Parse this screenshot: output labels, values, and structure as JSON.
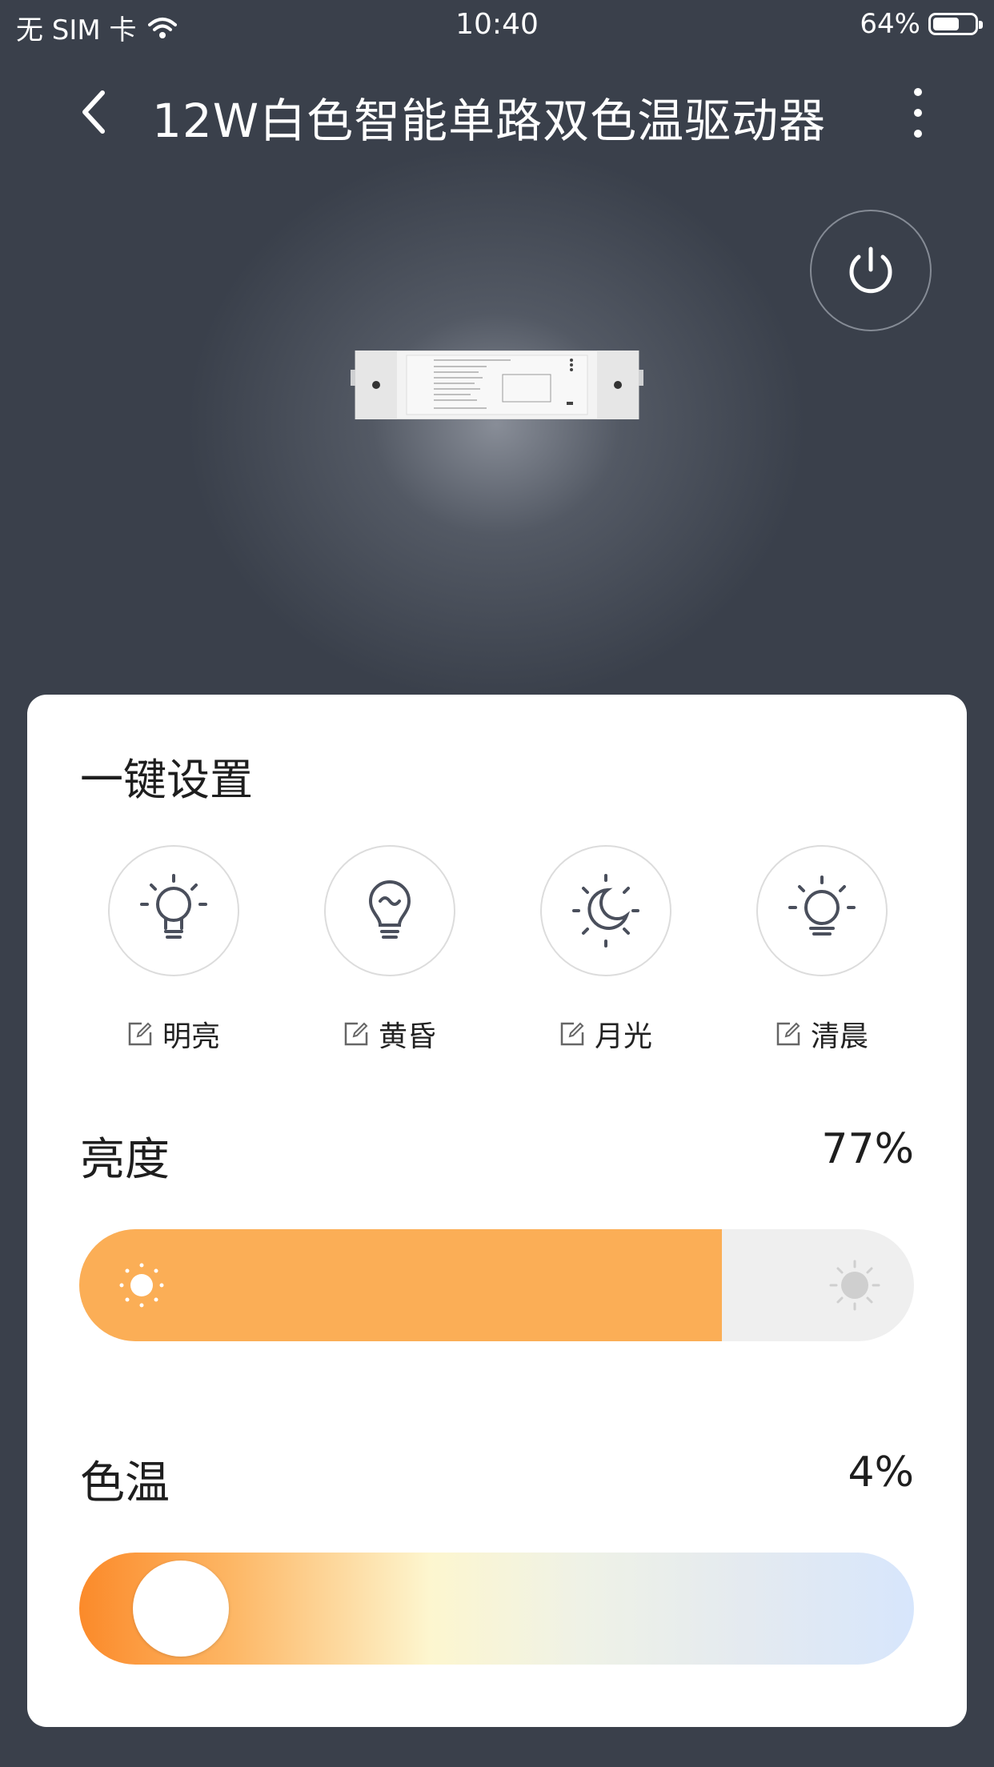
{
  "status_bar": {
    "carrier": "无 SIM 卡",
    "time": "10:40",
    "battery": "64%",
    "battery_level": 0.64
  },
  "nav": {
    "title": "12W白色智能单路双色温驱动器"
  },
  "presets": {
    "section_title": "一键设置",
    "items": [
      {
        "label": "明亮",
        "icon": "bulb-rays-icon"
      },
      {
        "label": "黄昏",
        "icon": "bulb-dusk-icon"
      },
      {
        "label": "月光",
        "icon": "moon-icon"
      },
      {
        "label": "清晨",
        "icon": "bulb-morning-icon"
      }
    ]
  },
  "brightness": {
    "label": "亮度",
    "value": "77%",
    "level": 0.77
  },
  "color_temp": {
    "label": "色温",
    "value": "4%",
    "level": 0.04
  },
  "colors": {
    "accent": "#fbae56",
    "background": "#3a404b"
  }
}
